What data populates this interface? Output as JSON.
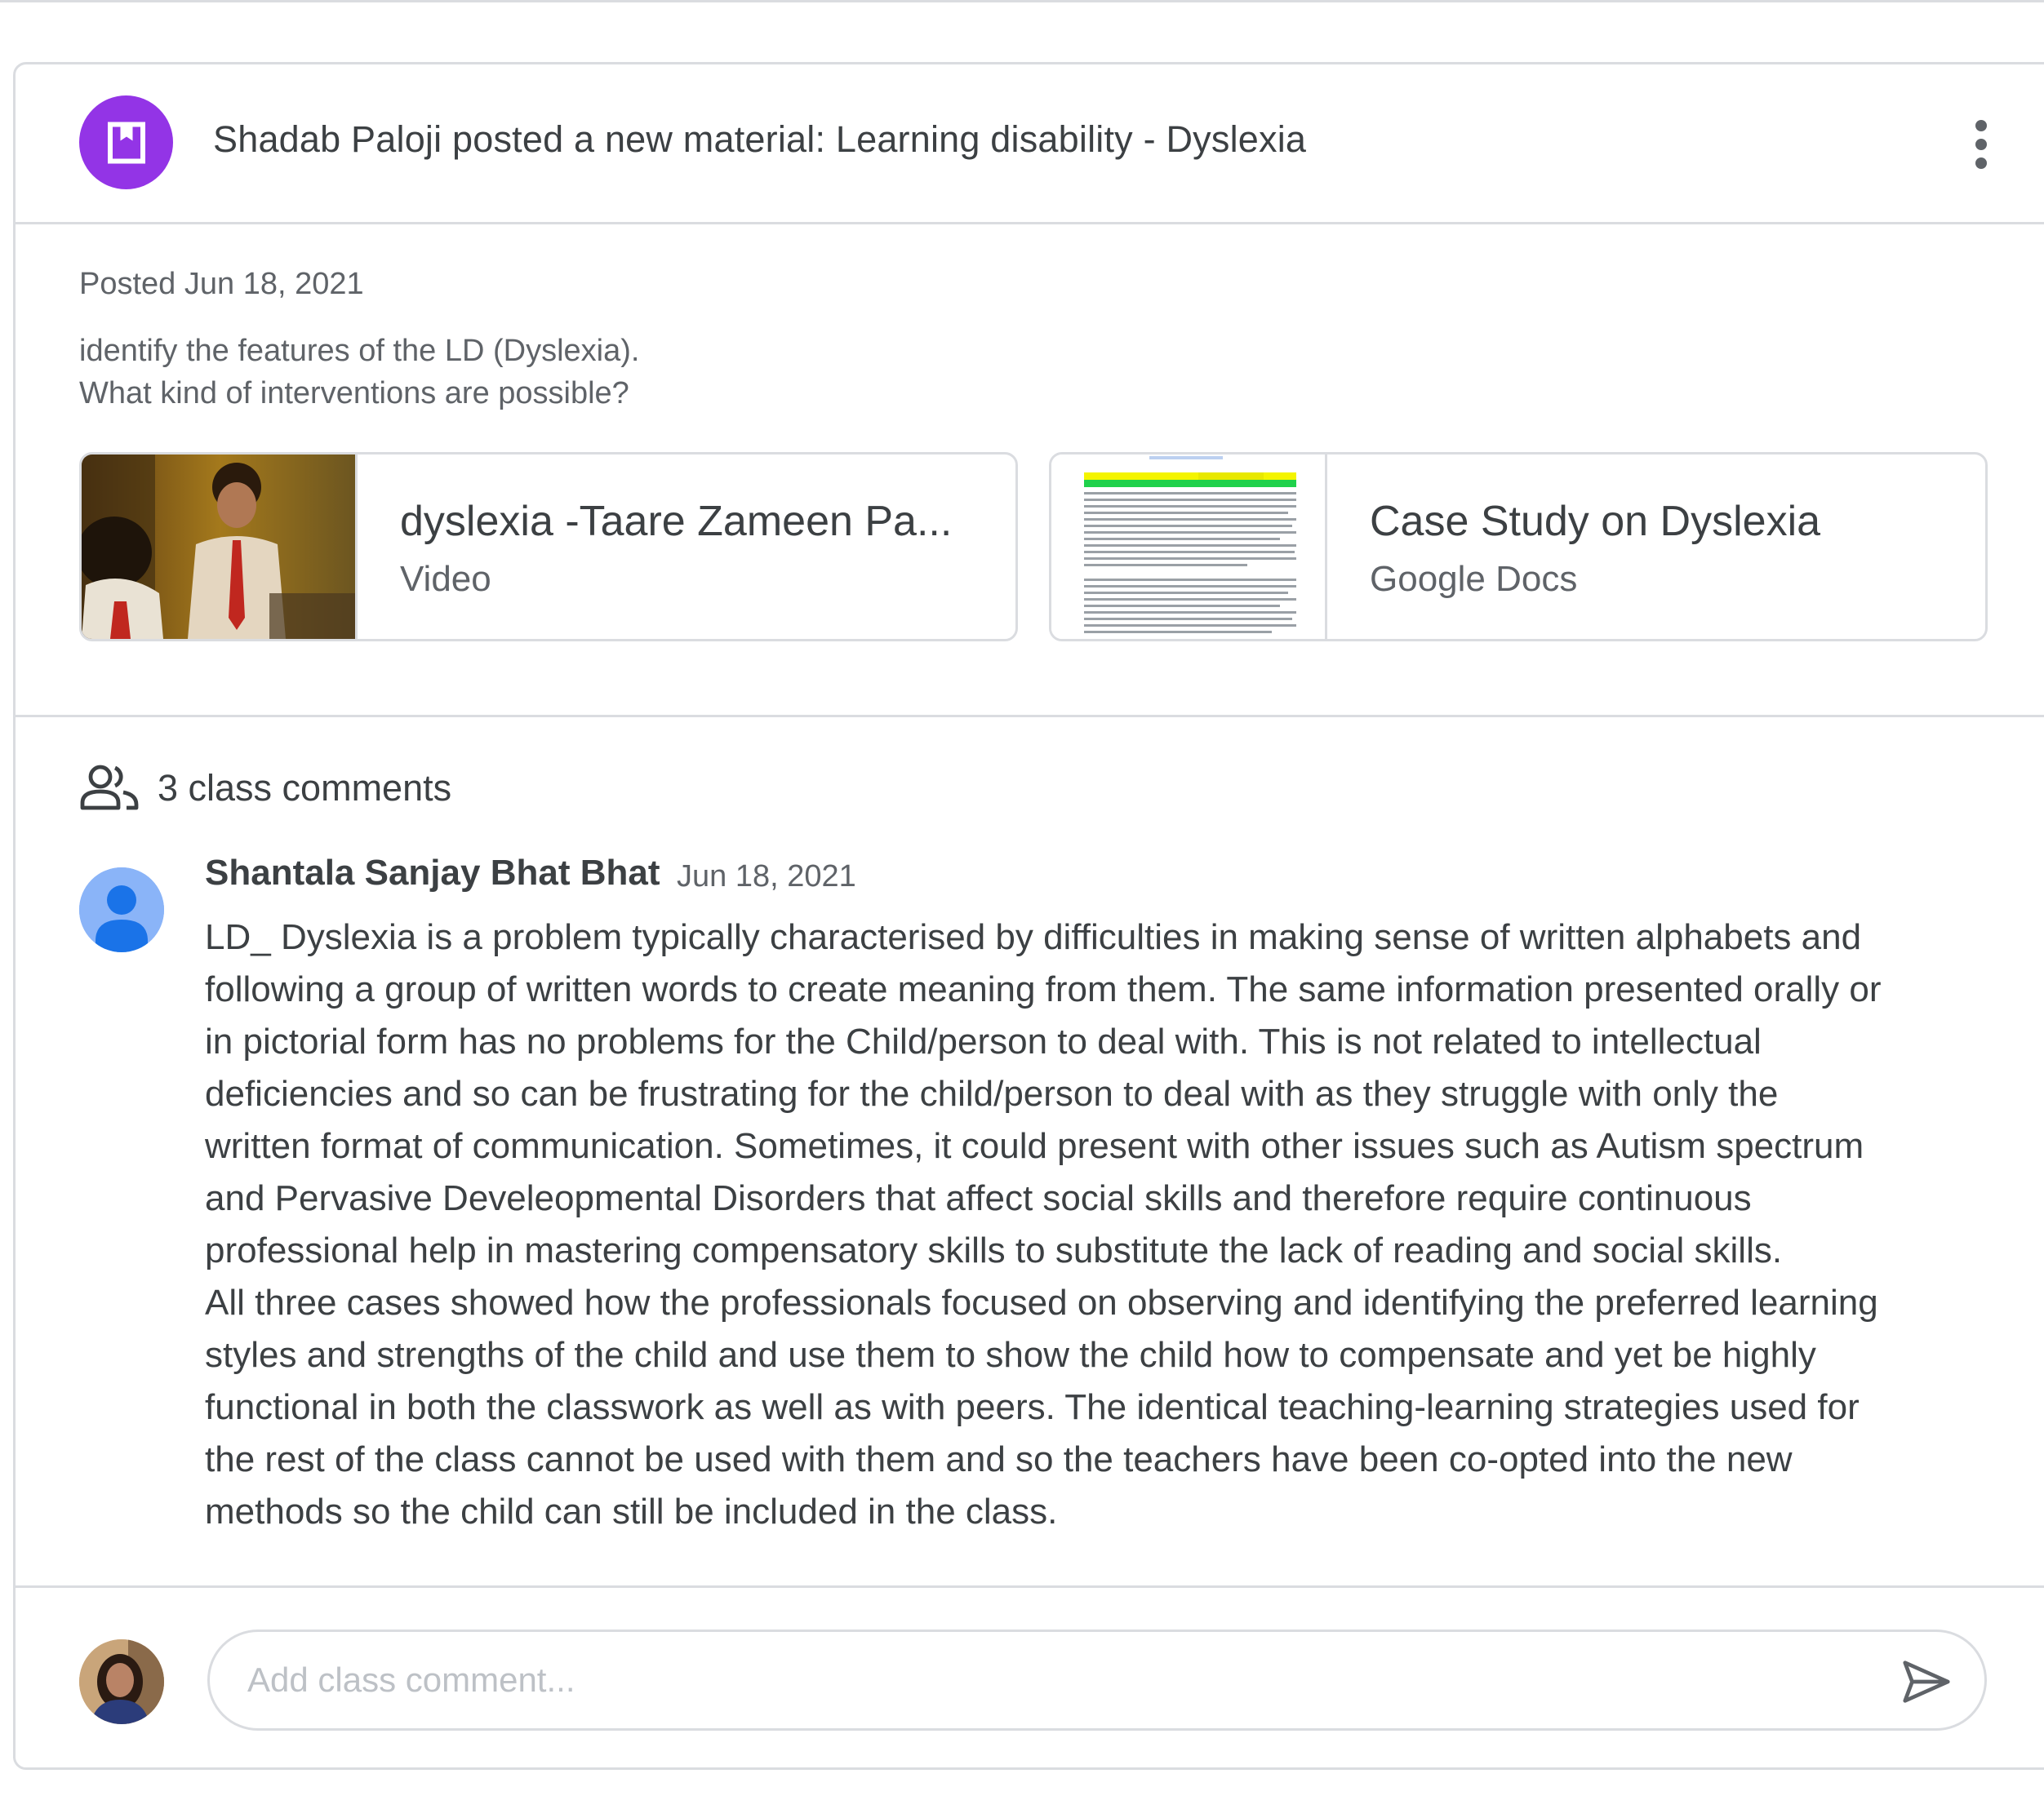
{
  "post": {
    "title": "Shadab Paloji posted a new material: Learning disability - Dyslexia",
    "header_icon": "material-bookmark-icon",
    "menu_icon": "more-vert-icon",
    "posted": "Posted Jun 18, 2021",
    "description": [
      "identify the features of the LD (Dyslexia).",
      "What kind of interventions are possible?"
    ],
    "attachments": [
      {
        "title": "dyslexia -Taare Zameen Pa...",
        "type": "Video"
      },
      {
        "title": "Case Study on Dyslexia",
        "type": "Google Docs"
      }
    ]
  },
  "comments": {
    "icon": "people-icon",
    "count_label": "3 class comments",
    "items": [
      {
        "author": "Shantala Sanjay Bhat Bhat",
        "date": "Jun 18, 2021",
        "lines": [
          "LD_ Dyslexia is a problem typically characterised by difficulties in making sense of written alphabets and",
          "following a group of written words to create meaning from them. The same information presented orally or",
          "in pictorial form has no problems for the Child/person to deal with. This is not related to intellectual",
          "deficiencies and so can be frustrating for the child/person to deal with as they struggle with only the",
          "written format of communication. Sometimes, it could present with other issues such as Autism spectrum",
          "and Pervasive Develeopmental Disorders that affect social skills and therefore require continuous",
          "professional help in mastering compensatory skills to substitute the lack of reading and social skills.",
          "All three cases showed how the professionals focused on observing and identifying the preferred learning",
          "styles and strengths of the child and use them to show the child how to compensate and yet be highly",
          "functional in both the classwork as well as with peers. The identical teaching-learning strategies used for",
          "the rest of the class cannot be used with them and so the teachers have been co-opted into the new",
          "methods so the child can still be included in the class."
        ]
      }
    ]
  },
  "compose": {
    "placeholder": "Add class comment...",
    "value": "",
    "send_icon": "send-icon"
  },
  "colors": {
    "accent_purple": "#9334e6",
    "avatar_blue": "#8ab4f8",
    "avatar_blue_dark": "#1a73e8",
    "border": "#dadce0",
    "text": "#3c4043",
    "secondary_text": "#5f6368"
  }
}
